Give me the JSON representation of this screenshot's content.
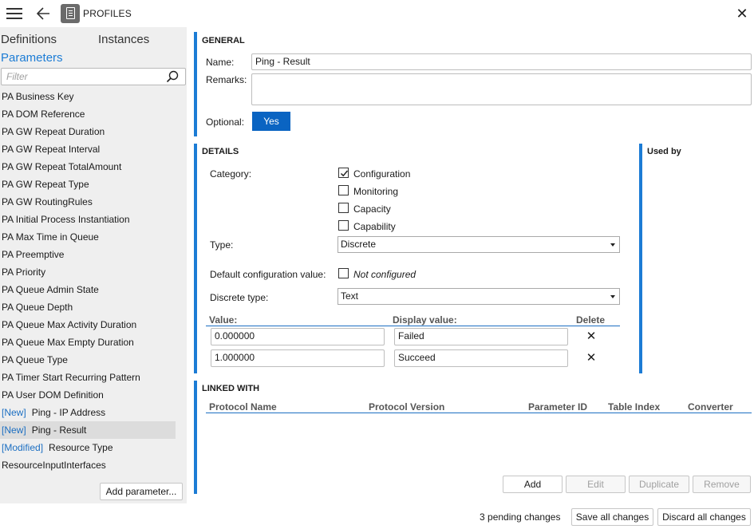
{
  "app": {
    "title": "PROFILES"
  },
  "icons": {
    "menu": "hamburger-icon",
    "back": "arrow-left-icon",
    "app": "document-icon",
    "close": "close-icon",
    "search": "search-icon",
    "check": "checkmark-icon",
    "delete": "x-icon",
    "dropdown": "caret-down-icon"
  },
  "colors": {
    "accent": "#1c7cd5",
    "primary_button": "#0a64c2",
    "sidebar_bg": "#efefef",
    "selected_row": "#dcdcdc"
  },
  "sidebar": {
    "tabs": {
      "definitions": "Definitions",
      "instances": "Instances",
      "parameters": "Parameters"
    },
    "filter_placeholder": "Filter",
    "items": [
      {
        "tag": "",
        "label": "PA Business Key"
      },
      {
        "tag": "",
        "label": "PA DOM Reference"
      },
      {
        "tag": "",
        "label": "PA GW Repeat Duration"
      },
      {
        "tag": "",
        "label": "PA GW Repeat Interval"
      },
      {
        "tag": "",
        "label": "PA GW Repeat TotalAmount"
      },
      {
        "tag": "",
        "label": "PA GW Repeat Type"
      },
      {
        "tag": "",
        "label": "PA GW RoutingRules"
      },
      {
        "tag": "",
        "label": "PA Initial Process Instantiation"
      },
      {
        "tag": "",
        "label": "PA Max Time in Queue"
      },
      {
        "tag": "",
        "label": "PA Preemptive"
      },
      {
        "tag": "",
        "label": "PA Priority"
      },
      {
        "tag": "",
        "label": "PA Queue Admin State"
      },
      {
        "tag": "",
        "label": "PA Queue Depth"
      },
      {
        "tag": "",
        "label": "PA Queue Max Activity Duration"
      },
      {
        "tag": "",
        "label": "PA Queue Max Empty Duration"
      },
      {
        "tag": "",
        "label": "PA Queue Type"
      },
      {
        "tag": "",
        "label": "PA Timer Start Recurring Pattern"
      },
      {
        "tag": "",
        "label": "PA User DOM Definition"
      },
      {
        "tag": "[New]",
        "label": "Ping - IP Address"
      },
      {
        "tag": "[New]",
        "label": "Ping - Result"
      },
      {
        "tag": "[Modified]",
        "label": "Resource Type"
      },
      {
        "tag": "",
        "label": "ResourceInputInterfaces"
      }
    ],
    "selected_index": 19,
    "add_button": "Add parameter..."
  },
  "general": {
    "title": "GENERAL",
    "name_label": "Name:",
    "name_value": "Ping - Result",
    "remarks_label": "Remarks:",
    "remarks_value": "",
    "optional_label": "Optional:",
    "optional_value": "Yes"
  },
  "details": {
    "title": "DETAILS",
    "category_label": "Category:",
    "categories": [
      {
        "label": "Configuration",
        "checked": true
      },
      {
        "label": "Monitoring",
        "checked": false
      },
      {
        "label": "Capacity",
        "checked": false
      },
      {
        "label": "Capability",
        "checked": false
      }
    ],
    "type_label": "Type:",
    "type_value": "Discrete",
    "default_label": "Default configuration value:",
    "default_checkbox_label": "Not configured",
    "default_checked": false,
    "discrete_type_label": "Discrete type:",
    "discrete_type_value": "Text",
    "columns": {
      "value": "Value:",
      "display": "Display value:",
      "delete": "Delete"
    },
    "rows": [
      {
        "value": "0.000000",
        "display": "Failed"
      },
      {
        "value": "1.000000",
        "display": "Succeed"
      }
    ]
  },
  "used_by": {
    "title": "Used by"
  },
  "linked": {
    "title": "LINKED WITH",
    "columns": [
      "Protocol Name",
      "Protocol Version",
      "Parameter ID",
      "Table Index",
      "Converter"
    ],
    "buttons": {
      "add": "Add",
      "edit": "Edit",
      "duplicate": "Duplicate",
      "remove": "Remove"
    }
  },
  "footer": {
    "pending_count": "3",
    "pending_text": "pending  changes",
    "save_all": "Save all changes",
    "discard_all": "Discard all changes"
  }
}
